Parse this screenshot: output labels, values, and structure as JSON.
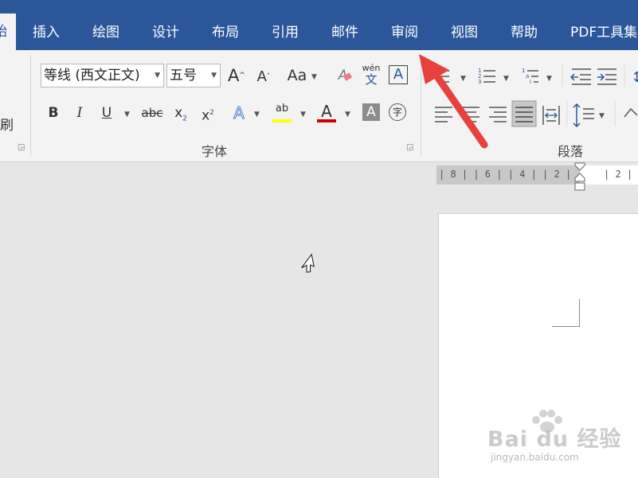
{
  "tabs": {
    "home_fragment": "始",
    "items": [
      "插入",
      "绘图",
      "设计",
      "布局",
      "引用",
      "邮件",
      "审阅",
      "视图",
      "帮助",
      "PDF工具集"
    ]
  },
  "clipboard": {
    "format_painter_fragment": "刷"
  },
  "font": {
    "family": "等线 (西文正文)",
    "size": "五号",
    "grow": "A",
    "shrink": "A",
    "change_case": "Aa",
    "clear_format": "A",
    "phonetic_top": "wén",
    "phonetic_bottom": "文",
    "char_border": "A",
    "bold": "B",
    "italic": "I",
    "underline": "U",
    "strike": "abc",
    "subscript": "x",
    "subscript_mark": "2",
    "superscript": "x",
    "superscript_mark": "2",
    "text_effects": "A",
    "highlight": "ab",
    "font_color": "A",
    "char_shading": "A",
    "enclose": "字",
    "group_label": "字体"
  },
  "paragraph": {
    "group_label": "段落"
  },
  "ruler": {
    "left_text": "| 8 |  | 6 |  | 4 |  | 2 |",
    "right_text": "| 2 |"
  },
  "watermark": {
    "main": "Bai du 经验",
    "sub": "jingyan.baidu.com"
  },
  "colors": {
    "tabbar": "#2b579a",
    "ribbon": "#f3f3f3",
    "highlight_yellow": "#ffff00",
    "font_red": "#d00000",
    "arrow": "#e8403c"
  }
}
